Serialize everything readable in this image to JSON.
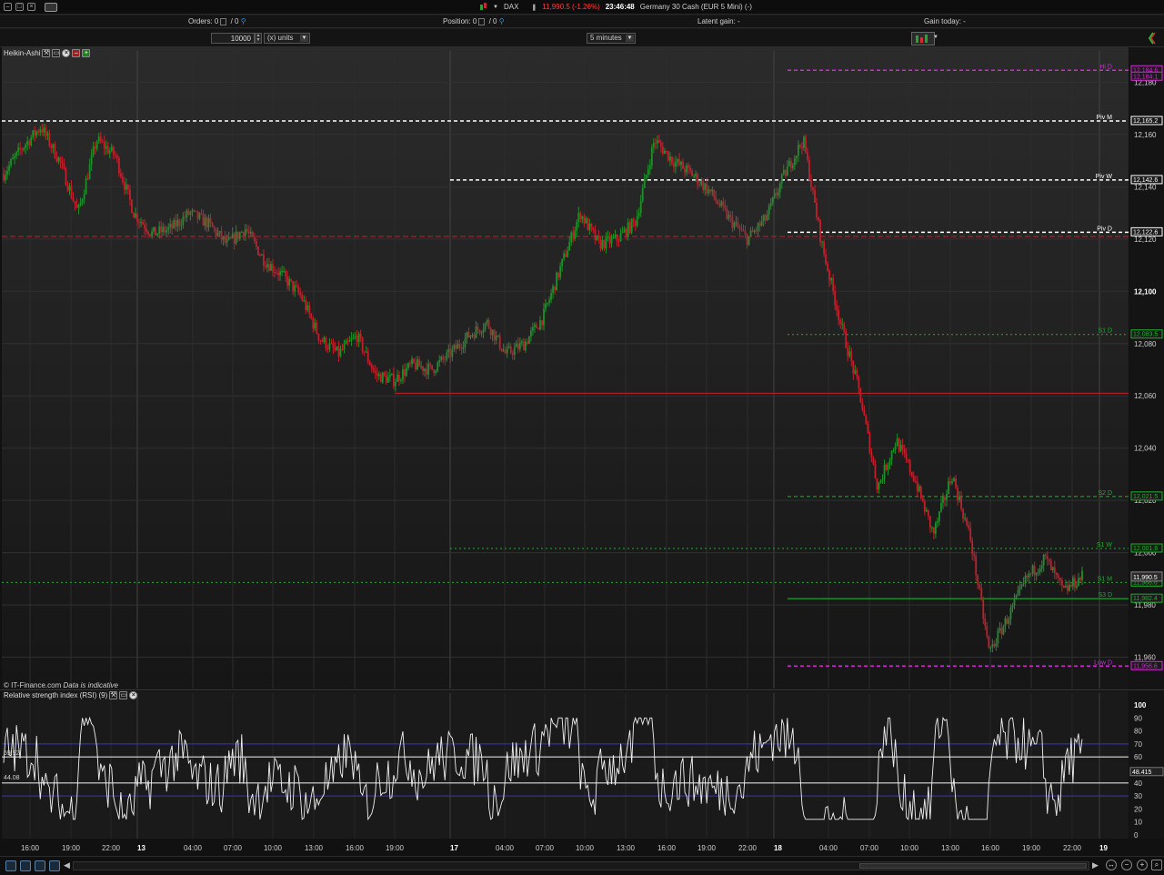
{
  "titlebar": {
    "instrument": "DAX",
    "price_change": "11,990.5 (-1.26%)",
    "time": "23:46:48",
    "description": "Germany 30 Cash (EUR 5 Mini) (-)"
  },
  "stats": {
    "orders_label": "Orders:",
    "orders_value": "0",
    "orders_sep": "/ 0",
    "position_label": "Position:",
    "position_value": "0",
    "position_sep": "/ 0",
    "latent_gain_label": "Latent gain: -",
    "gain_today_label": "Gain today: -"
  },
  "toolbar": {
    "quantity": "10000",
    "unit_mode": "(x) units",
    "timeframe": "5 minutes"
  },
  "price_panel": {
    "title": "Heikin-Ashi",
    "watermark_source": "© IT-Finance.com",
    "watermark_note": "Data is indicative",
    "price_ticks": [
      "12,180",
      "12,160",
      "12,140",
      "12,120",
      "12,100",
      "12,080",
      "12,060",
      "12,040",
      "12,020",
      "12,000",
      "11,980",
      "11,960"
    ],
    "tags": {
      "high_d": "12,184.6",
      "high_d_2": "12,184.1",
      "piv_m": "12,165.2",
      "piv_w": "12,142.6",
      "piv_d": "12,122.6",
      "s1_d": "12,083.5",
      "s2_d": "12,021.5",
      "s1_w": "12,001.6",
      "last": "11,990.5",
      "s1_m": "11,988.6",
      "s3_d": "11,982.4",
      "low_d": "11,956.6"
    },
    "level_labels": {
      "high_d": "Hi D",
      "piv_m": "Piv M",
      "piv_w": "Piv W",
      "piv_d": "Piv D",
      "s1_d": "S1 D",
      "s2_d": "S2 D",
      "s1_w": "S1 W",
      "s1_m": "S1 M",
      "s3_d": "S3 D",
      "low_d": "Low D"
    }
  },
  "rsi_panel": {
    "title": "Relative strength index (RSI) (9)",
    "ticks": [
      "100",
      "90",
      "80",
      "70",
      "60",
      "50",
      "40",
      "30",
      "20",
      "10",
      "0"
    ],
    "left_values": [
      "59.92",
      "44.08"
    ],
    "last_value": "48.415"
  },
  "time_axis": [
    "16:00",
    "19:00",
    "22:00",
    "13",
    "04:00",
    "07:00",
    "10:00",
    "13:00",
    "16:00",
    "19:00",
    "17",
    "04:00",
    "07:00",
    "10:00",
    "13:00",
    "16:00",
    "19:00",
    "22:00",
    "18",
    "04:00",
    "07:00",
    "10:00",
    "13:00",
    "16:00",
    "19:00",
    "22:00",
    "19"
  ],
  "colors": {
    "bull": "#1f8f2a",
    "bear": "#c0202c",
    "pivot": "#ffffff",
    "support": "#1fae2e",
    "high_low": "#d02bd0",
    "red_level": "#c0202c"
  },
  "chart_data": {
    "type": "candlestick",
    "title": "Heikin-Ashi",
    "x": "time (5 minutes)",
    "ylim": [
      11948,
      12192
    ],
    "approx_path": [
      [
        0,
        12145
      ],
      [
        2,
        12155
      ],
      [
        4,
        12163
      ],
      [
        6,
        12150
      ],
      [
        8,
        12130
      ],
      [
        10,
        12158
      ],
      [
        12,
        12152
      ],
      [
        14,
        12130
      ],
      [
        16,
        12122
      ],
      [
        18,
        12124
      ],
      [
        20,
        12130
      ],
      [
        22,
        12126
      ],
      [
        24,
        12118
      ],
      [
        26,
        12124
      ],
      [
        28,
        12112
      ],
      [
        30,
        12106
      ],
      [
        32,
        12098
      ],
      [
        34,
        12082
      ],
      [
        36,
        12076
      ],
      [
        38,
        12083
      ],
      [
        40,
        12068
      ],
      [
        42,
        12066
      ],
      [
        44,
        12072
      ],
      [
        46,
        12070
      ],
      [
        48,
        12076
      ],
      [
        50,
        12083
      ],
      [
        52,
        12088
      ],
      [
        54,
        12076
      ],
      [
        56,
        12080
      ],
      [
        58,
        12090
      ],
      [
        60,
        12110
      ],
      [
        62,
        12130
      ],
      [
        64,
        12118
      ],
      [
        66,
        12120
      ],
      [
        68,
        12127
      ],
      [
        70,
        12158
      ],
      [
        72,
        12150
      ],
      [
        74,
        12145
      ],
      [
        76,
        12138
      ],
      [
        78,
        12128
      ],
      [
        80,
        12120
      ],
      [
        82,
        12128
      ],
      [
        84,
        12145
      ],
      [
        86,
        12158
      ],
      [
        88,
        12118
      ],
      [
        90,
        12088
      ],
      [
        92,
        12062
      ],
      [
        94,
        12025
      ],
      [
        96,
        12043
      ],
      [
        98,
        12028
      ],
      [
        100,
        12007
      ],
      [
        102,
        12030
      ],
      [
        104,
        12005
      ],
      [
        106,
        11962
      ],
      [
        108,
        11975
      ],
      [
        110,
        11990
      ],
      [
        112,
        11998
      ],
      [
        114,
        11985
      ],
      [
        116,
        11991
      ]
    ],
    "levels": [
      {
        "name": "Hi D",
        "value": 12184.6
      },
      {
        "name": "Piv M",
        "value": 12165.2
      },
      {
        "name": "Piv W",
        "value": 12142.6
      },
      {
        "name": "Piv D",
        "value": 12122.6
      },
      {
        "name": "S1 D",
        "value": 12083.5
      },
      {
        "name": "S2 D",
        "value": 12021.5
      },
      {
        "name": "S1 W",
        "value": 12001.6
      },
      {
        "name": "S1 M",
        "value": 11988.6
      },
      {
        "name": "S3 D",
        "value": 11982.4
      },
      {
        "name": "Low D",
        "value": 11956.6
      }
    ],
    "horizontal_lines": [
      12121,
      12061
    ],
    "last_price": 11990.5,
    "rsi": {
      "period": 9,
      "ylim": [
        0,
        100
      ],
      "bands": [
        70,
        60,
        40,
        30
      ],
      "last": 48.415
    }
  }
}
